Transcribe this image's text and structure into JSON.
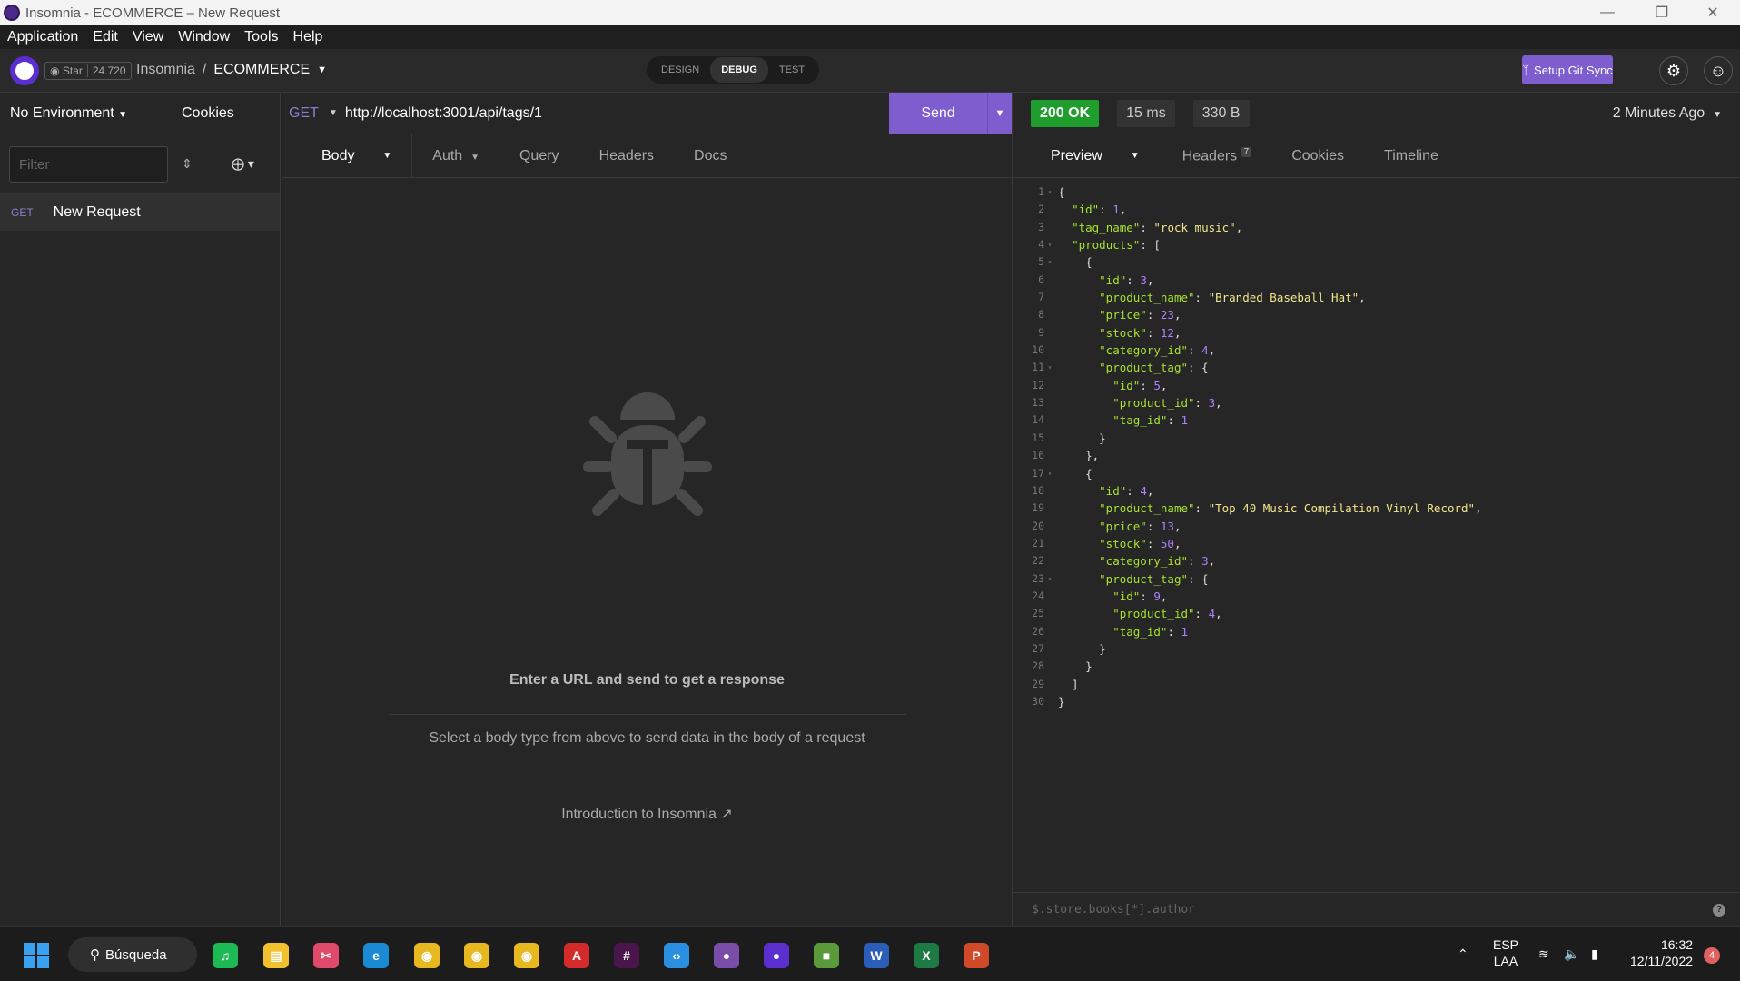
{
  "window": {
    "title": "Insomnia - ECOMMERCE – New Request"
  },
  "menu": [
    "Application",
    "Edit",
    "View",
    "Window",
    "Tools",
    "Help"
  ],
  "header": {
    "star_label": "Star",
    "star_count": "24.720",
    "app_name": "Insomnia",
    "separator": "/",
    "project": "ECOMMERCE",
    "modes": [
      "DESIGN",
      "DEBUG",
      "TEST"
    ],
    "active_mode": "DEBUG",
    "git_sync_label": "Setup Git Sync"
  },
  "sidebar": {
    "environment": "No Environment",
    "cookies": "Cookies",
    "filter_placeholder": "Filter",
    "requests": [
      {
        "method": "GET",
        "name": "New Request"
      }
    ]
  },
  "request": {
    "method": "GET",
    "url": "http://localhost:3001/api/tags/1",
    "send_label": "Send",
    "tabs": [
      "Body",
      "Auth",
      "Query",
      "Headers",
      "Docs"
    ],
    "empty_title": "Enter a URL and send to get a response",
    "empty_sub": "Select a body type from above to send data in the body of a request",
    "intro_link": "Introduction to Insomnia"
  },
  "response": {
    "status": "200 OK",
    "time": "15 ms",
    "size": "330 B",
    "ago": "2 Minutes Ago",
    "tabs": [
      "Preview",
      "Headers",
      "Cookies",
      "Timeline"
    ],
    "headers_count": "7",
    "filter_placeholder": "$.store.books[*].author",
    "lines": [
      "{",
      "  \"id\": 1,",
      "  \"tag_name\": \"rock music\",",
      "  \"products\": [",
      "    {",
      "      \"id\": 3,",
      "      \"product_name\": \"Branded Baseball Hat\",",
      "      \"price\": 23,",
      "      \"stock\": 12,",
      "      \"category_id\": 4,",
      "      \"product_tag\": {",
      "        \"id\": 5,",
      "        \"product_id\": 3,",
      "        \"tag_id\": 1",
      "      }",
      "    },",
      "    {",
      "      \"id\": 4,",
      "      \"product_name\": \"Top 40 Music Compilation Vinyl Record\",",
      "      \"price\": 13,",
      "      \"stock\": 50,",
      "      \"category_id\": 3,",
      "      \"product_tag\": {",
      "        \"id\": 9,",
      "        \"product_id\": 4,",
      "        \"tag_id\": 1",
      "      }",
      "    }",
      "  ]",
      "}"
    ],
    "foldable_lines": [
      1,
      4,
      5,
      11,
      17,
      23
    ]
  },
  "taskbar": {
    "search_label": "Búsqueda",
    "lang": "ESP",
    "region": "LAA",
    "time": "16:32",
    "date": "12/11/2022",
    "notifications": "4",
    "apps": [
      "spotify-icon",
      "file-explorer-icon",
      "snipping-tool-icon",
      "edge-icon",
      "chrome-icon",
      "chrome-icon",
      "chrome-icon",
      "acrobat-icon",
      "slack-icon",
      "vscode-icon",
      "github-desktop-icon",
      "insomnia-icon",
      "minecraft-icon",
      "word-icon",
      "excel-icon",
      "powerpoint-icon"
    ]
  },
  "colors": {
    "accent": "#7e5ecf",
    "ok": "#1f9e2e",
    "method": "#8b7fd4"
  }
}
